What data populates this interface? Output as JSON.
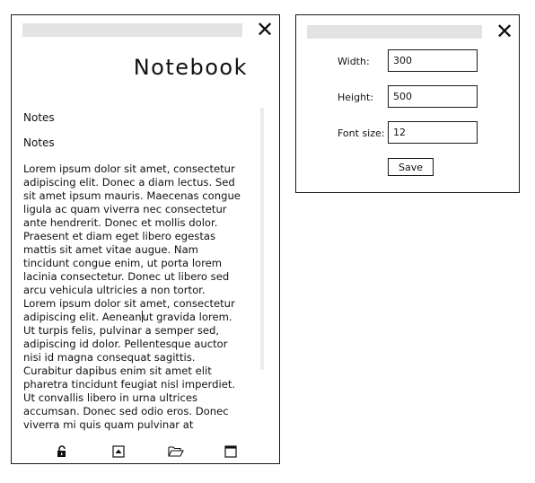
{
  "notebook": {
    "title": "Notebook",
    "notes_label_1": "Notes",
    "notes_label_2": "Notes",
    "body_before_caret": "Lorem ipsum dolor sit amet, consectetur\nadipiscing elit. Donec a diam lectus. Sed\nsit amet ipsum mauris. Maecenas congue\nligula ac quam viverra nec consectetur\nante hendrerit. Donec et mollis dolor.\nPraesent et diam eget libero egestas\nmattis sit amet vitae augue. Nam\ntincidunt congue enim, ut porta lorem\nlacinia consectetur. Donec ut libero sed\narcu vehicula ultricies a non tortor.\nLorem ipsum dolor sit amet, consectetur\nadipiscing elit. Aenean",
    "body_after_caret": "ut gravida lorem.\nUt turpis felis, pulvinar a semper sed,\nadipiscing id dolor. Pellentesque auctor\nnisi id magna consequat sagittis.\nCurabitur dapibus enim sit amet elit\npharetra tincidunt feugiat nisl imperdiet.\nUt convallis libero in urna ultrices\naccumsan. Donec sed odio eros. Donec\nviverra mi quis quam pulvinar at",
    "toolbar_icons": [
      "lock-open-icon",
      "eject-up-icon",
      "folder-open-icon",
      "window-icon"
    ]
  },
  "settings": {
    "width_label": "Width:",
    "width_value": "300",
    "height_label": "Height:",
    "height_value": "500",
    "font_size_label": "Font size:",
    "font_size_value": "12",
    "save_label": "Save"
  },
  "close_glyph": "✕"
}
